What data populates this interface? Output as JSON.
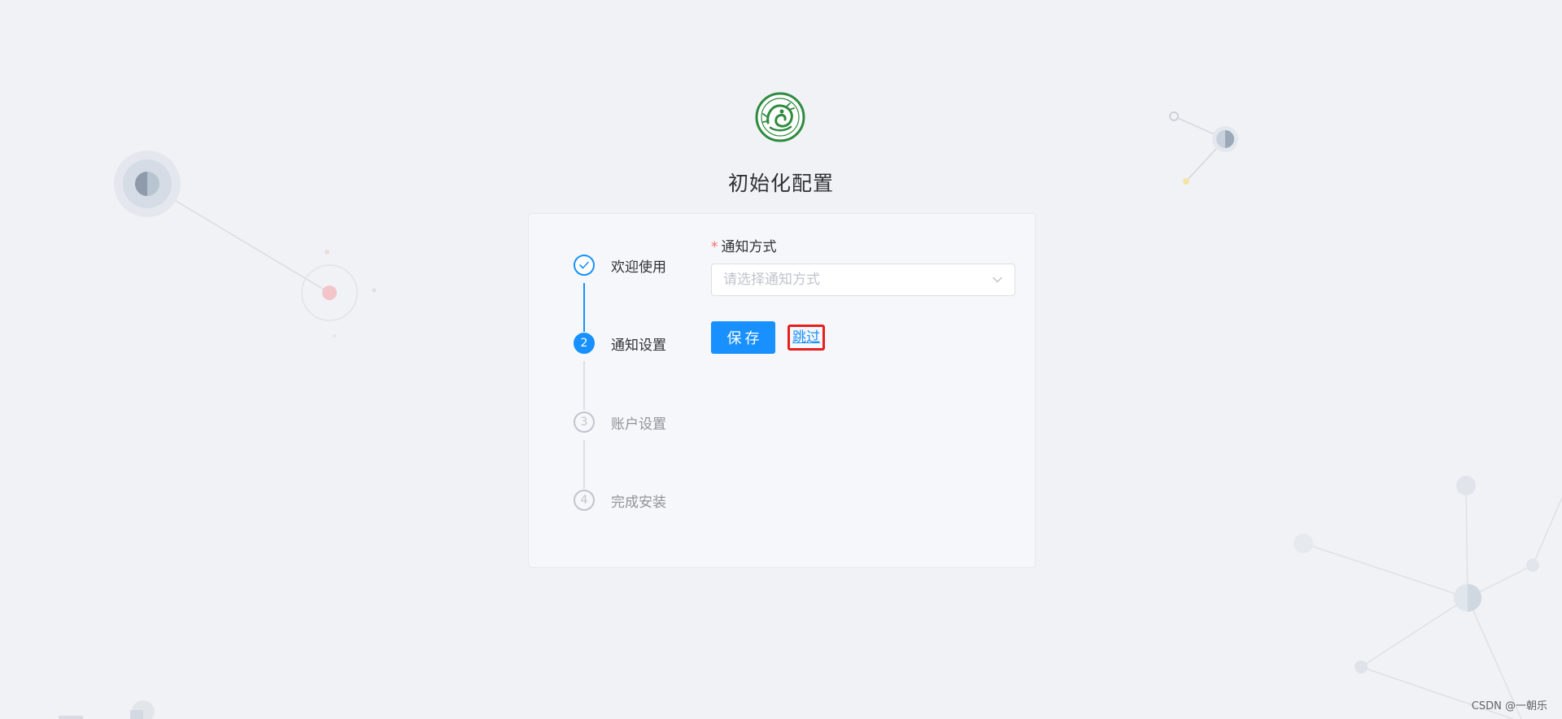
{
  "page": {
    "title": "初始化配置",
    "watermark": "CSDN @一朝乐"
  },
  "steps": [
    {
      "number": "1",
      "label": "欢迎使用",
      "status": "done"
    },
    {
      "number": "2",
      "label": "通知设置",
      "status": "active"
    },
    {
      "number": "3",
      "label": "账户设置",
      "status": "wait"
    },
    {
      "number": "4",
      "label": "完成安装",
      "status": "wait"
    }
  ],
  "form": {
    "notify_label": "通知方式",
    "required_mark": "*",
    "notify_placeholder": "请选择通知方式",
    "notify_value": ""
  },
  "actions": {
    "save_label": "保存",
    "skip_label": "跳过"
  },
  "colors": {
    "primary": "#1890ff",
    "background": "#f0f2f5",
    "highlight_border": "#e81f1f",
    "logo_green": "#2e8b3e"
  },
  "icons": {
    "logo": "dragon-emblem-icon",
    "done_step": "check-icon",
    "select_arrow": "chevron-down-icon"
  }
}
